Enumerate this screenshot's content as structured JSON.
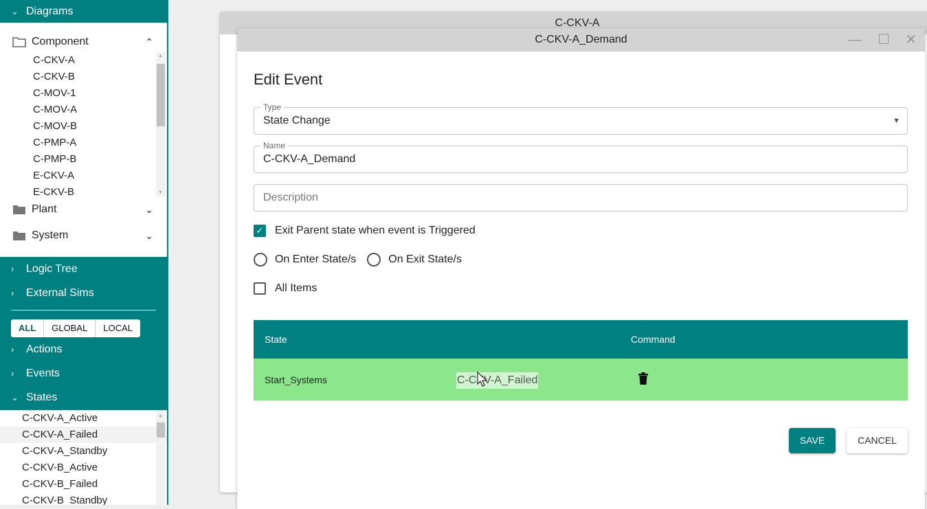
{
  "sidebar": {
    "diagrams": "Diagrams",
    "folders": [
      {
        "label": "Component",
        "icon": "folder-open-icon",
        "expanded": true
      },
      {
        "label": "Plant",
        "icon": "folder-icon"
      },
      {
        "label": "System",
        "icon": "folder-icon"
      }
    ],
    "component_items": [
      "C-CKV-A",
      "C-CKV-B",
      "C-MOV-1",
      "C-MOV-A",
      "C-MOV-B",
      "C-PMP-A",
      "C-PMP-B",
      "E-CKV-A",
      "E-CKV-B"
    ],
    "logic_tree": "Logic Tree",
    "external_sims": "External Sims",
    "filters": [
      "ALL",
      "GLOBAL",
      "LOCAL"
    ],
    "actions": "Actions",
    "events": "Events",
    "states": "States",
    "state_items": [
      "C-CKV-A_Active",
      "C-CKV-A_Failed",
      "C-CKV-A_Standby",
      "C-CKV-B_Active",
      "C-CKV-B_Failed",
      "C-CKV-B_Standby"
    ]
  },
  "back_window": {
    "title": "C-CKV-A"
  },
  "dialog": {
    "title": "C-CKV-A_Demand",
    "heading": "Edit Event",
    "type_label": "Type",
    "type_value": "State Change",
    "name_label": "Name",
    "name_value": "C-CKV-A_Demand",
    "description_placeholder": "Description",
    "exit_parent": {
      "label": "Exit Parent state when event is Triggered",
      "checked": true
    },
    "on_enter": "On Enter State/s",
    "on_exit": "On Exit State/s",
    "all_items": {
      "label": "All Items",
      "checked": false
    },
    "table": {
      "headers": [
        "State",
        "Command"
      ],
      "rows": [
        {
          "state": "Start_Systems"
        }
      ]
    },
    "drag_ghost": "C-CKV-A_Failed",
    "save": "SAVE",
    "cancel": "CANCEL"
  },
  "colors": {
    "accent": "#008080",
    "row": "#8ce68c"
  }
}
